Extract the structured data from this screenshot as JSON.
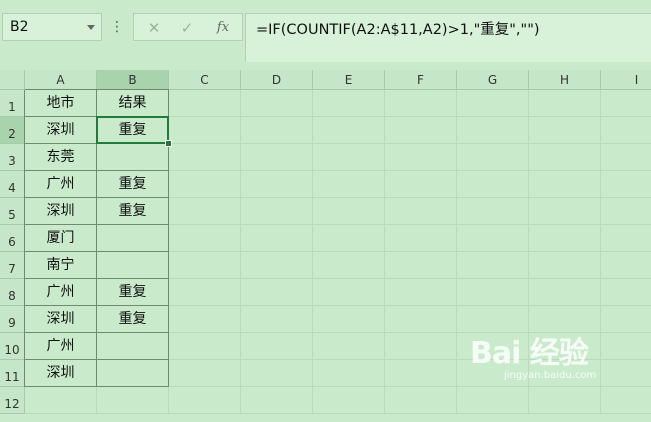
{
  "name_box": {
    "value": "B2"
  },
  "formula_bar": {
    "more_glyph": "⋮",
    "cancel_glyph": "✕",
    "confirm_glyph": "✓",
    "fx_glyph": "fx",
    "formula": "=IF(COUNTIF(A2:A$11,A2)>1,\"重复\",\"\")"
  },
  "sheet": {
    "columns": [
      "A",
      "B",
      "C",
      "D",
      "E",
      "F",
      "G",
      "H",
      "I"
    ],
    "rows": [
      "1",
      "2",
      "3",
      "4",
      "5",
      "6",
      "7",
      "8",
      "9",
      "10",
      "11",
      "12"
    ],
    "selected_column": "B",
    "selected_row": "2",
    "col_a": [
      "地市",
      "深圳",
      "东莞",
      "广州",
      "深圳",
      "厦门",
      "南宁",
      "广州",
      "深圳",
      "广州",
      "深圳",
      ""
    ],
    "col_b": [
      "结果",
      "重复",
      "",
      "重复",
      "重复",
      "",
      "",
      "重复",
      "重复",
      "",
      "",
      ""
    ]
  },
  "watermark": {
    "main": "Bai 经验",
    "sub": "jingyan.baidu.com"
  }
}
